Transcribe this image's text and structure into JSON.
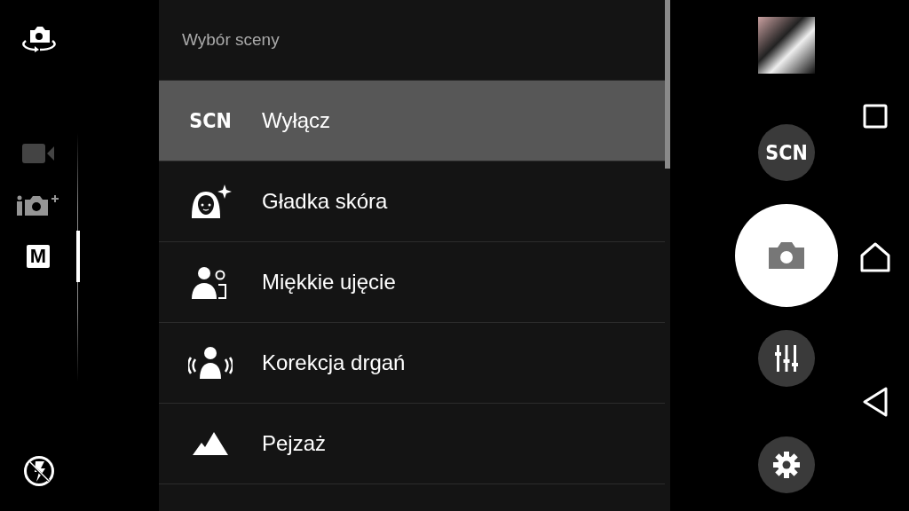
{
  "modes": [
    {
      "kind": "video",
      "selected": false
    },
    {
      "kind": "superior-auto",
      "selected": false
    },
    {
      "kind": "manual",
      "label": "M",
      "selected": true
    }
  ],
  "scene_menu": {
    "title": "Wybór sceny",
    "items": [
      {
        "kind": "scn",
        "icon_text": "SCN",
        "label": "Wyłącz",
        "selected": true
      },
      {
        "kind": "soft-skin",
        "label": "Gładka skóra",
        "selected": false
      },
      {
        "kind": "soft-snap",
        "label": "Miękkie ujęcie",
        "selected": false
      },
      {
        "kind": "anti-blur",
        "label": "Korekcja drgań",
        "selected": false
      },
      {
        "kind": "landscape",
        "label": "Pejzaż",
        "selected": false
      }
    ]
  },
  "controls": {
    "scene_button": "SCN"
  }
}
